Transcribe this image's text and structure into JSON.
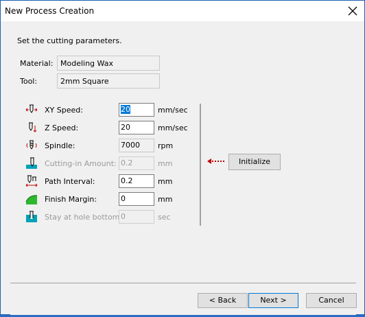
{
  "window": {
    "title": "New Process Creation"
  },
  "intro": "Set the cutting parameters.",
  "material": {
    "label": "Material:",
    "value": "Modeling Wax"
  },
  "tool": {
    "label": "Tool:",
    "value": "2mm Square"
  },
  "params": [
    {
      "label": "XY Speed:",
      "value": "20",
      "unit": "mm/sec",
      "state": "editable",
      "icon": "xy-speed-icon"
    },
    {
      "label": "Z Speed:",
      "value": "20",
      "unit": "mm/sec",
      "state": "editable",
      "icon": "z-speed-icon"
    },
    {
      "label": "Spindle:",
      "value": "7000",
      "unit": "rpm",
      "state": "readonly",
      "icon": "spindle-icon"
    },
    {
      "label": "Cutting-in Amount:",
      "value": "0.2",
      "unit": "mm",
      "state": "disabled",
      "icon": "cutting-in-icon"
    },
    {
      "label": "Path Interval:",
      "value": "0.2",
      "unit": "mm",
      "state": "editable",
      "icon": "path-interval-icon"
    },
    {
      "label": "Finish Margin:",
      "value": "0",
      "unit": "mm",
      "state": "editable",
      "icon": "finish-margin-icon"
    },
    {
      "label": "Stay at hole bottom:",
      "value": "0",
      "unit": "sec",
      "state": "disabled",
      "icon": "stay-hole-icon"
    }
  ],
  "initialize_label": "Initialize",
  "footer": {
    "back": "< Back",
    "next": "Next >",
    "cancel": "Cancel"
  },
  "colors": {
    "accent": "#0078d7",
    "arrow": "#c00000",
    "icon_teal": "#00a2b8"
  }
}
